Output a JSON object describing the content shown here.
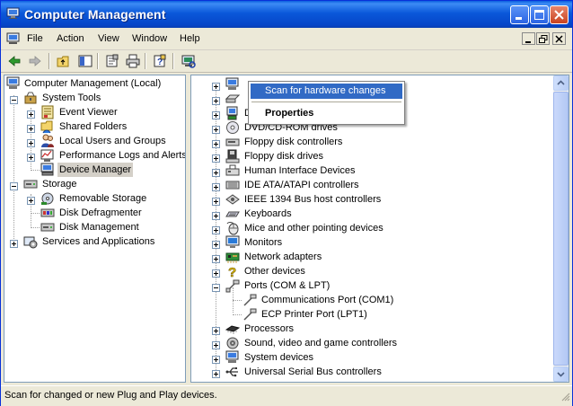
{
  "window": {
    "title": "Computer Management"
  },
  "menu": [
    {
      "label": "File",
      "name": "menu-file"
    },
    {
      "label": "Action",
      "name": "menu-action"
    },
    {
      "label": "View",
      "name": "menu-view"
    },
    {
      "label": "Window",
      "name": "menu-window"
    },
    {
      "label": "Help",
      "name": "menu-help"
    }
  ],
  "left_tree": [
    {
      "label": "Computer Management (Local)",
      "level": 0,
      "expander": "none",
      "icon": "computer-icon"
    },
    {
      "label": "System Tools",
      "level": 1,
      "expander": "minus",
      "icon": "tools-icon"
    },
    {
      "label": "Event Viewer",
      "level": 2,
      "expander": "plus",
      "icon": "event-viewer-icon"
    },
    {
      "label": "Shared Folders",
      "level": 2,
      "expander": "plus",
      "icon": "shared-folders-icon"
    },
    {
      "label": "Local Users and Groups",
      "level": 2,
      "expander": "plus",
      "icon": "users-icon"
    },
    {
      "label": "Performance Logs and Alerts",
      "level": 2,
      "expander": "plus",
      "icon": "performance-icon"
    },
    {
      "label": "Device Manager",
      "level": 2,
      "expander": "none",
      "icon": "device-manager-icon",
      "selected": true
    },
    {
      "label": "Storage",
      "level": 1,
      "expander": "minus",
      "icon": "storage-icon"
    },
    {
      "label": "Removable Storage",
      "level": 2,
      "expander": "plus",
      "icon": "removable-storage-icon"
    },
    {
      "label": "Disk Defragmenter",
      "level": 2,
      "expander": "none",
      "icon": "defrag-icon"
    },
    {
      "label": "Disk Management",
      "level": 2,
      "expander": "none",
      "icon": "disk-management-icon"
    },
    {
      "label": "Services and Applications",
      "level": 1,
      "expander": "plus",
      "icon": "services-icon"
    }
  ],
  "device_tree": [
    {
      "label": "",
      "level": 0,
      "expander": "plus",
      "icon": "computer-icon"
    },
    {
      "label": "",
      "level": 0,
      "expander": "plus",
      "icon": "disk-drive-icon"
    },
    {
      "label": "D",
      "level": 0,
      "expander": "plus",
      "icon": "display-adapter-icon"
    },
    {
      "label": "DVD/CD-ROM drives",
      "level": 0,
      "expander": "plus",
      "icon": "cdrom-icon"
    },
    {
      "label": "Floppy disk controllers",
      "level": 0,
      "expander": "plus",
      "icon": "floppy-controller-icon"
    },
    {
      "label": "Floppy disk drives",
      "level": 0,
      "expander": "plus",
      "icon": "floppy-drive-icon"
    },
    {
      "label": "Human Interface Devices",
      "level": 0,
      "expander": "plus",
      "icon": "hid-icon"
    },
    {
      "label": "IDE ATA/ATAPI controllers",
      "level": 0,
      "expander": "plus",
      "icon": "ide-icon"
    },
    {
      "label": "IEEE 1394 Bus host controllers",
      "level": 0,
      "expander": "plus",
      "icon": "ieee1394-icon"
    },
    {
      "label": "Keyboards",
      "level": 0,
      "expander": "plus",
      "icon": "keyboard-icon"
    },
    {
      "label": "Mice and other pointing devices",
      "level": 0,
      "expander": "plus",
      "icon": "mouse-icon"
    },
    {
      "label": "Monitors",
      "level": 0,
      "expander": "plus",
      "icon": "monitor-icon"
    },
    {
      "label": "Network adapters",
      "level": 0,
      "expander": "plus",
      "icon": "network-adapter-icon"
    },
    {
      "label": "Other devices",
      "level": 0,
      "expander": "plus",
      "icon": "unknown-device-icon"
    },
    {
      "label": "Ports (COM & LPT)",
      "level": 0,
      "expander": "minus",
      "icon": "port-icon"
    },
    {
      "label": "Communications Port (COM1)",
      "level": 1,
      "expander": "none",
      "icon": "port-icon"
    },
    {
      "label": "ECP Printer Port (LPT1)",
      "level": 1,
      "expander": "none",
      "icon": "port-icon"
    },
    {
      "label": "Processors",
      "level": 0,
      "expander": "plus",
      "icon": "processor-icon"
    },
    {
      "label": "Sound, video and game controllers",
      "level": 0,
      "expander": "plus",
      "icon": "sound-icon"
    },
    {
      "label": "System devices",
      "level": 0,
      "expander": "plus",
      "icon": "system-device-icon"
    },
    {
      "label": "Universal Serial Bus controllers",
      "level": 0,
      "expander": "plus",
      "icon": "usb-icon"
    }
  ],
  "context_menu": {
    "scan": "Scan for hardware changes",
    "properties": "Properties"
  },
  "status": {
    "text": "Scan for changed or new Plug and Play devices."
  },
  "colors": {
    "title_bar": "#0a58da",
    "menu_highlight": "#316ac5",
    "chrome": "#ece9d8"
  }
}
